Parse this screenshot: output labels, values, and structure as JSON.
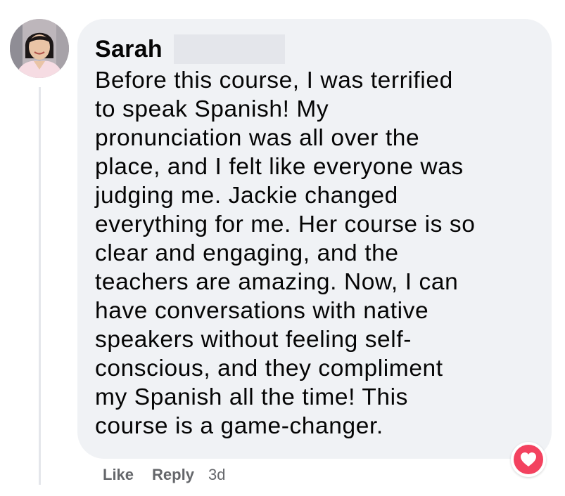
{
  "comment": {
    "author": "Sarah",
    "text": "Before this course, I was terrified\nto speak Spanish! My\npronunciation was all over the\nplace, and I felt like everyone was\njudging me. Jackie changed\neverything for me. Her course is so\nclear and engaging, and the\nteachers are amazing. Now, I can\nhave conversations with native\nspeakers without feeling self-\nconscious, and they compliment\nmy Spanish all the time! This\ncourse is a game-changer."
  },
  "reaction": {
    "icon": "heart-icon",
    "color": "#f3425f"
  },
  "actions": {
    "like_label": "Like",
    "reply_label": "Reply",
    "timestamp": "3d"
  },
  "colors": {
    "bubble": "#f0f2f5",
    "text": "#050505",
    "secondary_text": "#65676b"
  }
}
